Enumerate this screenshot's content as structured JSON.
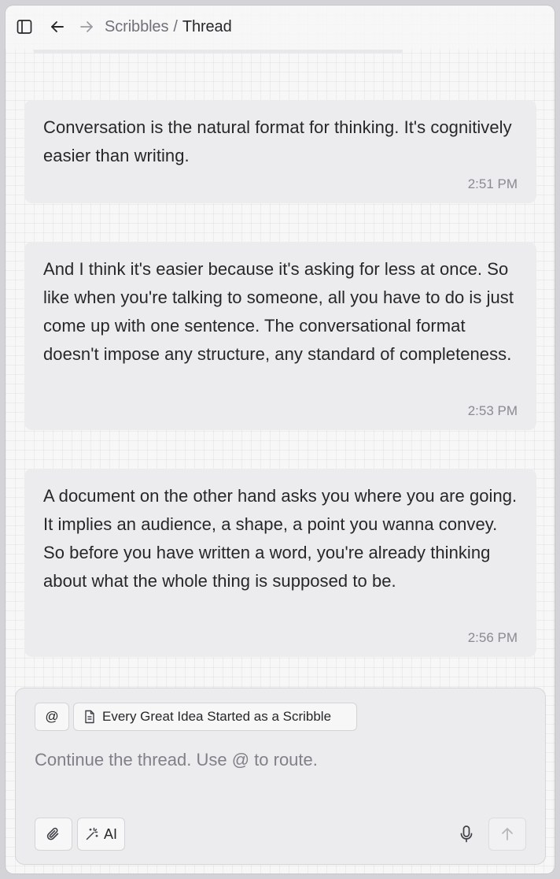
{
  "breadcrumb": {
    "parent": "Scribbles",
    "separator": "/",
    "current": "Thread"
  },
  "icons": {
    "sidebar": "sidebar-toggle-icon",
    "back": "arrow-left-icon",
    "forward": "arrow-right-icon",
    "document": "document-icon",
    "attach": "paperclip-icon",
    "ai": "magic-wand-icon",
    "mic": "microphone-icon",
    "send": "arrow-up-icon"
  },
  "messages": [
    {
      "text": "Conversation is the natural format for thinking. It's cognitively easier than writing.",
      "time": "2:51 PM"
    },
    {
      "text": "And I think it's easier because it's asking for less at once. So like when you're talking to someone, all you have to do is just come up with one sentence. The conversational format doesn't impose any structure, any standard of completeness.",
      "time": "2:53 PM"
    },
    {
      "text": "A document on the other hand asks you where you are going. It implies an audience, a shape, a point you wanna convey. So before you have written a word, you're already thinking about what the whole thing is supposed to be.",
      "time": "2:56 PM"
    }
  ],
  "composer": {
    "mention_label": "@",
    "route_chip": "Every Great Idea Started as a Scribble",
    "placeholder": "Continue the thread. Use @ to route.",
    "value": "",
    "ai_label": "AI"
  },
  "colors": {
    "background": "#f7f7f8",
    "bubble": "#ececee",
    "text": "#27272a",
    "muted": "#8a8a90"
  }
}
